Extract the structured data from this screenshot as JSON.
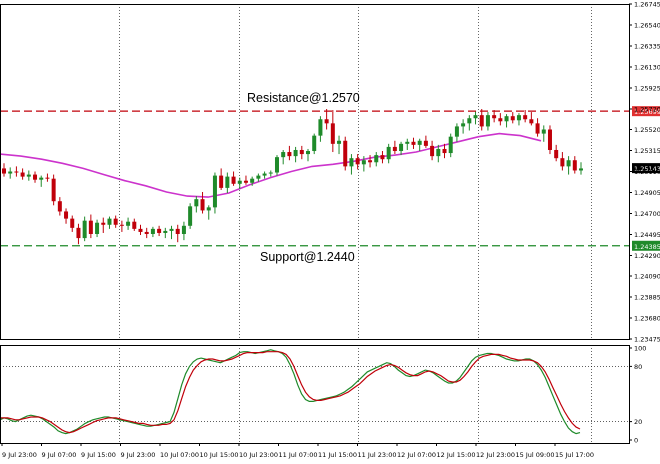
{
  "chart_data": [
    {
      "type": "candlestick",
      "y_ticks": [
        "1.26745",
        "1.26540",
        "1.26335",
        "1.26130",
        "1.25925",
        "1.25720",
        "1.25520",
        "1.25315",
        "1.25110",
        "1.24905",
        "1.24700",
        "1.24495",
        "1.24290",
        "1.24090",
        "1.23885",
        "1.23680",
        "1.23475"
      ],
      "x_ticks": [
        "9 Jul 23:00",
        "9 Jul 07:00",
        "9 Jul 15:00",
        "9 Jul 23:00",
        "10 Jul 07:00",
        "10 Jul 15:00",
        "10 Jul 23:00",
        "11 Jul 07:00",
        "11 Jul 15:00",
        "11 Jul 23:00",
        "12 Jul 07:00",
        "12 Jul 15:00",
        "12 Jul 23:00",
        "15 Jul 09:00",
        "15 Jul 17:00"
      ],
      "ylim": [
        1.23475,
        1.26745
      ],
      "grid": "vertical dotted",
      "horizontal_lines": [
        {
          "label": "Resistance@1.2570",
          "tag": "1.25699",
          "value": 1.25699,
          "color": "#c0000a",
          "tag_color": "#e03030"
        },
        {
          "label": "Support@1.2440",
          "tag": "1.24385",
          "value": 1.24385,
          "color": "#1f8a2a",
          "tag_color": "#1f8a2a"
        }
      ],
      "current_price": {
        "tag": "1.25143",
        "value": 1.25143,
        "tag_color": "#000000"
      },
      "moving_average_color": "#cc33cc",
      "up_color": "#1f8a2a",
      "down_color": "#c0000a",
      "candles": [
        [
          1.2514,
          1.2519,
          1.2506,
          1.2509
        ],
        [
          1.2509,
          1.2515,
          1.2504,
          1.2511
        ],
        [
          1.2511,
          1.2516,
          1.2506,
          1.251
        ],
        [
          1.251,
          1.2514,
          1.2503,
          1.2506
        ],
        [
          1.2506,
          1.2512,
          1.2502,
          1.2508
        ],
        [
          1.2508,
          1.2511,
          1.25,
          1.2503
        ],
        [
          1.2503,
          1.2507,
          1.2496,
          1.2505
        ],
        [
          1.2505,
          1.2509,
          1.2501,
          1.2504
        ],
        [
          1.2504,
          1.2508,
          1.2478,
          1.2482
        ],
        [
          1.2482,
          1.2486,
          1.2468,
          1.2472
        ],
        [
          1.2472,
          1.2475,
          1.246,
          1.2465
        ],
        [
          1.2465,
          1.2468,
          1.2452,
          1.2456
        ],
        [
          1.2456,
          1.246,
          1.244,
          1.2446
        ],
        [
          1.2446,
          1.2467,
          1.2443,
          1.2463
        ],
        [
          1.2463,
          1.2469,
          1.2446,
          1.245
        ],
        [
          1.245,
          1.2464,
          1.2447,
          1.2461
        ],
        [
          1.2461,
          1.2466,
          1.2451,
          1.2459
        ],
        [
          1.2459,
          1.2467,
          1.2455,
          1.2465
        ],
        [
          1.2465,
          1.2468,
          1.2456,
          1.2459
        ],
        [
          1.2459,
          1.2463,
          1.2452,
          1.2458
        ],
        [
          1.2458,
          1.2466,
          1.2454,
          1.2462
        ],
        [
          1.2462,
          1.2465,
          1.2453,
          1.2455
        ],
        [
          1.2455,
          1.2459,
          1.2449,
          1.2452
        ],
        [
          1.2452,
          1.2456,
          1.2446,
          1.245
        ],
        [
          1.245,
          1.2457,
          1.2447,
          1.2455
        ],
        [
          1.2455,
          1.2458,
          1.2448,
          1.2451
        ],
        [
          1.2451,
          1.2456,
          1.2446,
          1.2453
        ],
        [
          1.2453,
          1.2458,
          1.2445,
          1.2455
        ],
        [
          1.2455,
          1.2459,
          1.2442,
          1.245
        ],
        [
          1.245,
          1.2462,
          1.2444,
          1.2458
        ],
        [
          1.2458,
          1.248,
          1.2455,
          1.2477
        ],
        [
          1.2477,
          1.2487,
          1.2471,
          1.2484
        ],
        [
          1.2484,
          1.2491,
          1.247,
          1.2473
        ],
        [
          1.2473,
          1.2478,
          1.2464,
          1.2476
        ],
        [
          1.2476,
          1.251,
          1.247,
          1.2507
        ],
        [
          1.2507,
          1.2514,
          1.2493,
          1.2495
        ],
        [
          1.2495,
          1.251,
          1.249,
          1.2506
        ],
        [
          1.2506,
          1.2511,
          1.2497,
          1.2499
        ],
        [
          1.2499,
          1.2505,
          1.2494,
          1.2502
        ],
        [
          1.2502,
          1.2507,
          1.2498,
          1.25
        ],
        [
          1.25,
          1.2506,
          1.2497,
          1.2504
        ],
        [
          1.2504,
          1.2509,
          1.2501,
          1.2507
        ],
        [
          1.2507,
          1.2511,
          1.2504,
          1.2509
        ],
        [
          1.2509,
          1.2512,
          1.2506,
          1.251
        ],
        [
          1.251,
          1.2527,
          1.2507,
          1.2525
        ],
        [
          1.2525,
          1.2532,
          1.2518,
          1.253
        ],
        [
          1.253,
          1.2536,
          1.2522,
          1.2526
        ],
        [
          1.2526,
          1.2535,
          1.252,
          1.2532
        ],
        [
          1.2532,
          1.2536,
          1.2523,
          1.2528
        ],
        [
          1.2528,
          1.2533,
          1.2521,
          1.2531
        ],
        [
          1.2531,
          1.2548,
          1.2528,
          1.2546
        ],
        [
          1.2546,
          1.2565,
          1.254,
          1.2562
        ],
        [
          1.2562,
          1.2572,
          1.2552,
          1.2558
        ],
        [
          1.2558,
          1.2571,
          1.253,
          1.2538
        ],
        [
          1.2538,
          1.2546,
          1.2528,
          1.2541
        ],
        [
          1.2541,
          1.2545,
          1.2512,
          1.2516
        ],
        [
          1.2516,
          1.2528,
          1.2508,
          1.2524
        ],
        [
          1.2524,
          1.2528,
          1.2513,
          1.2518
        ],
        [
          1.2518,
          1.2526,
          1.2511,
          1.2522
        ],
        [
          1.2522,
          1.2527,
          1.2515,
          1.252
        ],
        [
          1.252,
          1.253,
          1.2516,
          1.2527
        ],
        [
          1.2527,
          1.2531,
          1.2519,
          1.2523
        ],
        [
          1.2523,
          1.2538,
          1.2519,
          1.2535
        ],
        [
          1.2535,
          1.2541,
          1.2528,
          1.2531
        ],
        [
          1.2531,
          1.254,
          1.2527,
          1.2538
        ],
        [
          1.2538,
          1.2543,
          1.2532,
          1.254
        ],
        [
          1.254,
          1.2544,
          1.2533,
          1.2537
        ],
        [
          1.2537,
          1.2543,
          1.2531,
          1.2541
        ],
        [
          1.2541,
          1.2546,
          1.2534,
          1.2536
        ],
        [
          1.2536,
          1.2541,
          1.2522,
          1.2526
        ],
        [
          1.2526,
          1.2537,
          1.252,
          1.2533
        ],
        [
          1.2533,
          1.2538,
          1.2524,
          1.2529
        ],
        [
          1.2529,
          1.2548,
          1.2525,
          1.2545
        ],
        [
          1.2545,
          1.2558,
          1.254,
          1.2555
        ],
        [
          1.2555,
          1.2562,
          1.2548,
          1.2558
        ],
        [
          1.2558,
          1.2566,
          1.2551,
          1.2563
        ],
        [
          1.2563,
          1.257,
          1.2557,
          1.2566
        ],
        [
          1.2566,
          1.2572,
          1.2551,
          1.2555
        ],
        [
          1.2555,
          1.2569,
          1.2551,
          1.2566
        ],
        [
          1.2566,
          1.2571,
          1.2559,
          1.2563
        ],
        [
          1.2563,
          1.2568,
          1.2556,
          1.256
        ],
        [
          1.256,
          1.2567,
          1.2554,
          1.2565
        ],
        [
          1.2565,
          1.2569,
          1.2558,
          1.2561
        ],
        [
          1.2561,
          1.2568,
          1.2556,
          1.2566
        ],
        [
          1.2566,
          1.2571,
          1.2559,
          1.2562
        ],
        [
          1.2562,
          1.2569,
          1.2556,
          1.2558
        ],
        [
          1.2558,
          1.2563,
          1.2545,
          1.2548
        ],
        [
          1.2548,
          1.2556,
          1.254,
          1.2552
        ],
        [
          1.2552,
          1.2556,
          1.2528,
          1.2532
        ],
        [
          1.2532,
          1.2537,
          1.2521,
          1.2524
        ],
        [
          1.2524,
          1.253,
          1.2512,
          1.2516
        ],
        [
          1.2516,
          1.2526,
          1.2508,
          1.2522
        ],
        [
          1.2522,
          1.2526,
          1.2509,
          1.2512
        ],
        [
          1.2512,
          1.252,
          1.2508,
          1.2514
        ]
      ],
      "moving_average": [
        1.2528,
        1.2526,
        1.2523,
        1.2519,
        1.2514,
        1.2508,
        1.2502,
        1.2497,
        1.2491,
        1.2487,
        1.2486,
        1.249,
        1.2498,
        1.2505,
        1.2511,
        1.2516,
        1.2518,
        1.2521,
        1.2525,
        1.2527,
        1.253,
        1.2535,
        1.254,
        1.2545,
        1.2548,
        1.2546,
        1.2541
      ],
      "oscillator_ylim": [
        0,
        100
      ],
      "oscillator_ticks": [
        "100",
        "80",
        "20",
        "0"
      ],
      "oscillator_levels": [
        80,
        20
      ],
      "oscillator_series": [
        {
          "color": "#1f8a2a",
          "values": [
            22,
            24,
            23,
            21,
            20,
            22,
            24,
            26,
            27,
            26,
            25,
            23,
            20,
            17,
            14,
            10,
            8,
            7,
            8,
            10,
            12,
            15,
            18,
            20,
            22,
            23,
            24,
            25,
            25,
            24,
            23,
            22,
            21,
            20,
            19,
            18,
            17,
            16,
            15,
            15,
            16,
            17,
            18,
            19,
            20,
            30,
            45,
            60,
            72,
            80,
            85,
            88,
            89,
            88,
            87,
            86,
            85,
            84,
            86,
            88,
            90,
            92,
            95,
            96,
            96,
            95,
            94,
            95,
            96,
            97,
            98,
            97,
            96,
            94,
            90,
            82,
            72,
            60,
            50,
            44,
            42,
            42,
            43,
            44,
            45,
            46,
            47,
            48,
            50,
            52,
            55,
            58,
            62,
            66,
            70,
            74,
            76,
            78,
            80,
            82,
            84,
            83,
            80,
            76,
            73,
            70,
            69,
            70,
            72,
            74,
            76,
            75,
            73,
            70,
            67,
            64,
            62,
            62,
            64,
            68,
            74,
            80,
            86,
            90,
            92,
            93,
            94,
            94,
            93,
            92,
            90,
            88,
            87,
            86,
            86,
            87,
            88,
            88,
            86,
            82,
            76,
            68,
            58,
            48,
            38,
            28,
            20,
            13,
            9,
            7,
            8
          ]
        },
        {
          "color": "#c0000a",
          "values": [
            24,
            24,
            24,
            23,
            22,
            22,
            23,
            24,
            25,
            25,
            25,
            24,
            22,
            20,
            17,
            14,
            11,
            9,
            8,
            9,
            11,
            13,
            15,
            17,
            19,
            21,
            22,
            23,
            24,
            24,
            24,
            23,
            22,
            21,
            20,
            19,
            18,
            18,
            17,
            16,
            16,
            16,
            17,
            17,
            18,
            22,
            32,
            45,
            58,
            68,
            76,
            81,
            85,
            87,
            88,
            88,
            87,
            86,
            86,
            87,
            88,
            90,
            92,
            94,
            95,
            95,
            95,
            95,
            95,
            96,
            96,
            96,
            96,
            95,
            93,
            88,
            80,
            70,
            60,
            52,
            47,
            44,
            43,
            43,
            44,
            45,
            46,
            47,
            48,
            50,
            52,
            55,
            58,
            61,
            65,
            69,
            72,
            75,
            77,
            79,
            81,
            82,
            81,
            79,
            76,
            73,
            71,
            70,
            70,
            72,
            74,
            75,
            74,
            72,
            70,
            67,
            64,
            63,
            63,
            65,
            69,
            74,
            80,
            85,
            89,
            91,
            92,
            93,
            93,
            93,
            92,
            91,
            89,
            88,
            87,
            87,
            87,
            87,
            86,
            84,
            80,
            74,
            66,
            57,
            48,
            39,
            31,
            24,
            18,
            14,
            12
          ]
        }
      ]
    }
  ]
}
